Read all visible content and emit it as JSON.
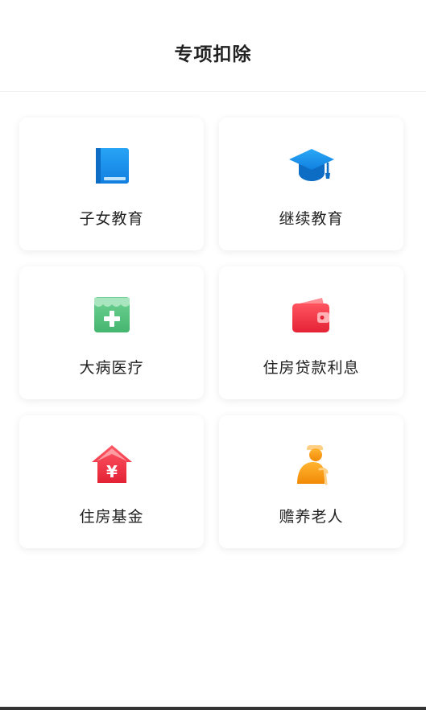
{
  "header": {
    "title": "专项扣除"
  },
  "items": [
    {
      "label": "子女教育",
      "icon": "book-icon",
      "color": "#1a8fe8"
    },
    {
      "label": "继续教育",
      "icon": "graduation-cap-icon",
      "color": "#1a8fe8"
    },
    {
      "label": "大病医疗",
      "icon": "medical-kit-icon",
      "color": "#5cc785"
    },
    {
      "label": "住房贷款利息",
      "icon": "wallet-icon",
      "color": "#f03c4c"
    },
    {
      "label": "住房基金",
      "icon": "house-yuan-icon",
      "color": "#f03c4c"
    },
    {
      "label": "赡养老人",
      "icon": "elderly-person-icon",
      "color": "#f7a11a"
    }
  ]
}
